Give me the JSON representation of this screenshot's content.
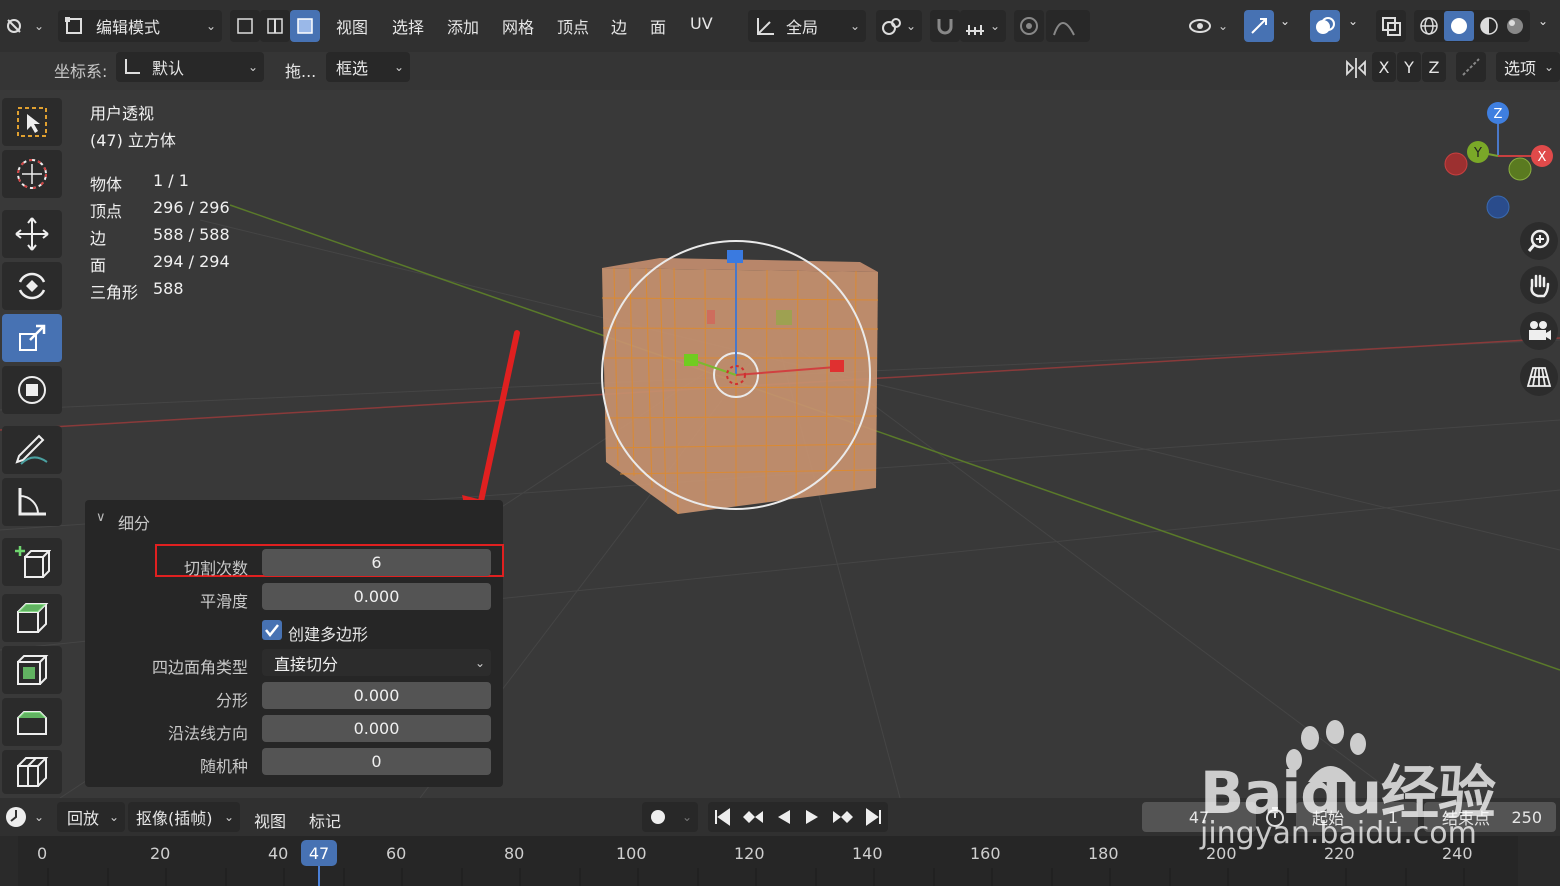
{
  "header": {
    "mode": "编辑模式",
    "menus": [
      "视图",
      "选择",
      "添加",
      "网格",
      "顶点",
      "边",
      "面",
      "UV"
    ],
    "transform_orientation": "全局"
  },
  "header2": {
    "coord_label": "坐标系:",
    "coord_value": "默认",
    "drag_label": "拖...",
    "select_mode": "框选",
    "axes": [
      "X",
      "Y",
      "Z"
    ],
    "options": "选项"
  },
  "viewport": {
    "view_name": "用户透视",
    "object_name": "(47) 立方体",
    "stats": [
      {
        "label": "物体",
        "value": "1 / 1"
      },
      {
        "label": "顶点",
        "value": "296 / 296"
      },
      {
        "label": "边",
        "value": "588 / 588"
      },
      {
        "label": "面",
        "value": "294 / 294"
      },
      {
        "label": "三角形",
        "value": "588"
      }
    ],
    "gizmo_axes": {
      "x": "X",
      "y": "Y",
      "z": "Z"
    }
  },
  "panel": {
    "title": "细分",
    "cuts_label": "切割次数",
    "cuts_value": "6",
    "smooth_label": "平滑度",
    "smooth_value": "0.000",
    "ngon_label": "创建多边形",
    "quad_label": "四边面角类型",
    "quad_value": "直接切分",
    "fractal_label": "分形",
    "fractal_value": "0.000",
    "normal_label": "沿法线方向",
    "normal_value": "0.000",
    "seed_label": "随机种",
    "seed_value": "0"
  },
  "timeline": {
    "playback": "回放",
    "keying": "抠像(插帧)",
    "view": "视图",
    "marker": "标记",
    "current_frame": "47",
    "start_label": "起始",
    "start_value": "1",
    "end_label": "结束点",
    "end_value": "250",
    "ticks": [
      "0",
      "20",
      "40",
      "60",
      "80",
      "100",
      "120",
      "140",
      "160",
      "180",
      "200",
      "220",
      "240"
    ],
    "current_marker": "47"
  },
  "watermark": {
    "brand": "Baidu经验",
    "url": "jingyan.baidu.com"
  }
}
